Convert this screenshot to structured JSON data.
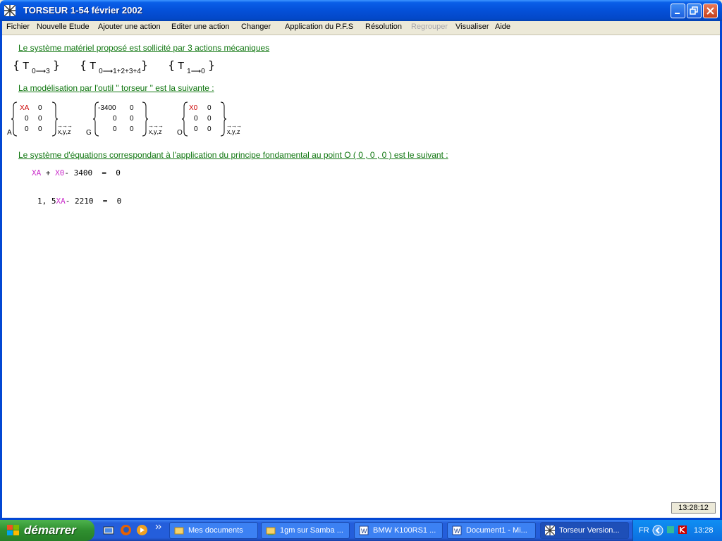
{
  "window": {
    "title": "TORSEUR 1-54  février 2002",
    "icon": "torseur-app-icon"
  },
  "menu": {
    "items": [
      {
        "label": "Fichier",
        "enabled": true
      },
      {
        "label": "Nouvelle Etude",
        "enabled": true
      },
      {
        "label": "Ajouter une action",
        "enabled": true
      },
      {
        "label": "Editer une action",
        "enabled": true
      },
      {
        "label": "Changer",
        "enabled": true
      },
      {
        "label": "Application du P.F.S",
        "enabled": true
      },
      {
        "label": "Résolution",
        "enabled": true
      },
      {
        "label": "Regrouper",
        "enabled": false
      },
      {
        "label": "Visualiser",
        "enabled": true
      },
      {
        "label": "Aide",
        "enabled": true
      }
    ]
  },
  "content": {
    "heading1": "Le système matériel proposé est sollicité par 3 actions mécaniques",
    "torseurs": [
      {
        "symbol": "T",
        "sub": "0⟶3"
      },
      {
        "symbol": "T",
        "sub": "0⟶1+2+3+4"
      },
      {
        "symbol": "T",
        "sub": "1⟶0"
      }
    ],
    "heading2": "La modélisation par l'outil \" torseur \" est la suivante :",
    "matrices": [
      {
        "point": "A",
        "cells": [
          [
            "XA",
            "0"
          ],
          [
            "0",
            "0"
          ],
          [
            "0",
            "0"
          ]
        ],
        "basis": "x,y,z"
      },
      {
        "point": "G",
        "cells": [
          [
            "-3400",
            "0"
          ],
          [
            "0",
            "0"
          ],
          [
            "0",
            "0"
          ]
        ],
        "basis": "x,y,z"
      },
      {
        "point": "O",
        "cells": [
          [
            "X0",
            "0"
          ],
          [
            "0",
            "0"
          ],
          [
            "0",
            "0"
          ]
        ],
        "basis": "x,y,z"
      }
    ],
    "heading3": "Le système d'équations correspondant à l'application du principe fondamental au point O ( 0 , 0 , 0 ) est le suivant :",
    "equation1": {
      "a": "XA",
      "op1": " + ",
      "b": "X0",
      "rest": "- 3400  =  0"
    },
    "equation2": {
      "pre": "1, 5",
      "a": "XA",
      "rest": "- 2210  =  0"
    }
  },
  "status": {
    "time": "13:28:12"
  },
  "taskbar": {
    "start_label": "démarrer",
    "tasks": [
      {
        "label": "Mes documents",
        "active": false
      },
      {
        "label": "1gm sur Samba ...",
        "active": false
      },
      {
        "label": "BMW K100RS1 ...",
        "active": false
      },
      {
        "label": "Document1 - Mi...",
        "active": false
      },
      {
        "label": "Torseur Version...",
        "active": true
      }
    ],
    "lang": "FR",
    "clock": "13:28"
  },
  "colors": {
    "heading": "#117711",
    "unknown_red": "#cc0000",
    "unknown_magenta": "#cc33cc"
  }
}
